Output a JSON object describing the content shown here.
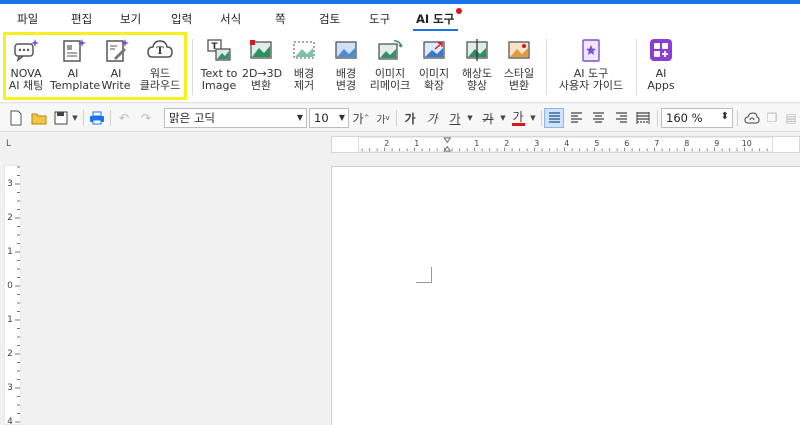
{
  "menubar": {
    "items": [
      "파일",
      "편집",
      "보기",
      "입력",
      "서식",
      "쪽",
      "검토",
      "도구",
      "AI 도구"
    ],
    "active": "AI 도구"
  },
  "ribbon": {
    "nova_chat": "NOVA\nAI 채팅",
    "ai_template": "AI\nTemplate",
    "ai_write": "AI\nWrite",
    "word_cloud": "워드\n클라우드",
    "text_to_image": "Text to\nImage",
    "two_d_to_three_d": "2D→3D\n변환",
    "remove_background": "배경\n제거",
    "change_background": "배경\n변경",
    "image_remake": "이미지\n리메이크",
    "image_expand": "이미지\n확장",
    "upscale": "해상도\n향상",
    "style_transform": "스타일\n변환",
    "ai_tools_guide": "AI 도구\n사용자 가이드",
    "ai_apps": "AI\nApps"
  },
  "toolbar": {
    "font_name": "맑은 고딕",
    "font_size": "10",
    "increase_font": "가",
    "decrease_font": "가",
    "bold": "가",
    "italic": "가",
    "underline": "가",
    "strikethrough": "가",
    "font_color": "가",
    "zoom": "160 %"
  },
  "rulers": {
    "h_labels": [
      "2",
      "1",
      "1",
      "2",
      "3",
      "4",
      "5",
      "6",
      "7",
      "8",
      "9",
      "10"
    ],
    "v_labels": [
      "3",
      "2",
      "1",
      "0",
      "1",
      "2",
      "3",
      "4"
    ],
    "corner": "L"
  },
  "colors": {
    "accent": "#1a73e8",
    "highlight": "#f7ef20",
    "font_color_bar": "#e0141c",
    "ai_apps": "#8a3fd1"
  }
}
